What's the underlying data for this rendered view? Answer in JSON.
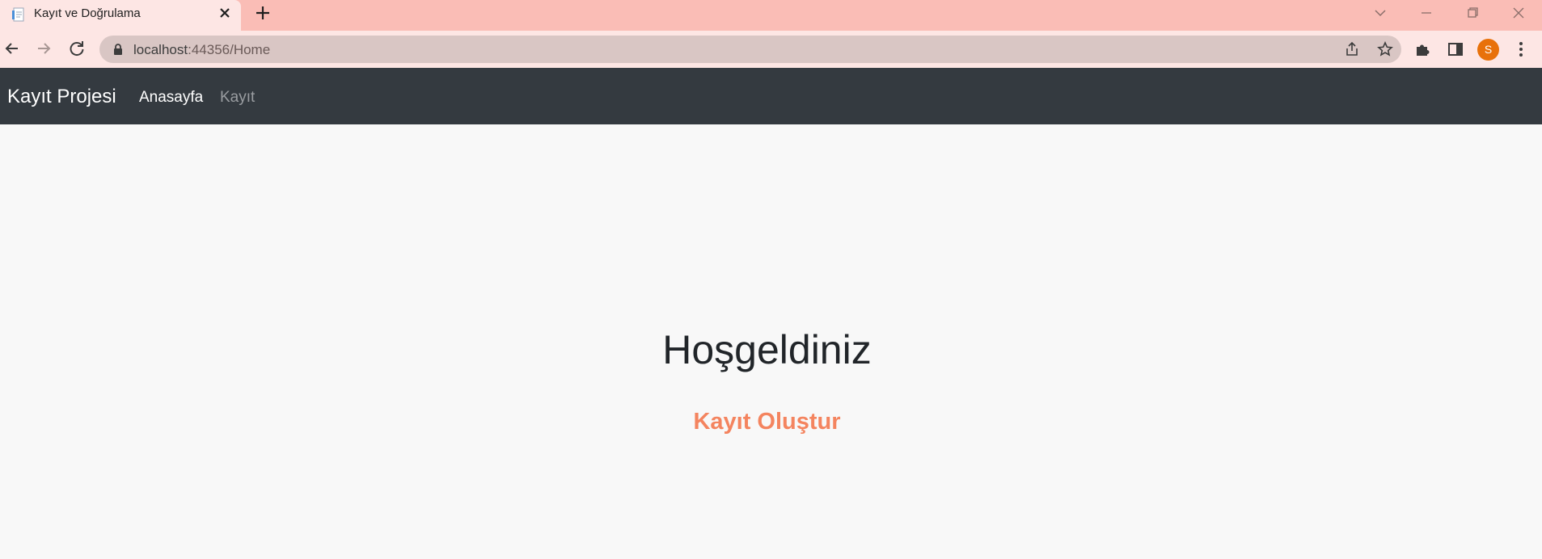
{
  "browser": {
    "tab_title": "Kayıt ve Doğrulama",
    "url_host": "localhost",
    "url_rest": ":44356/Home",
    "profile_initial": "S",
    "icons": {
      "favicon": "document-icon",
      "close": "close-icon",
      "new_tab": "plus-icon",
      "back": "back-arrow-icon",
      "forward": "forward-arrow-icon",
      "reload": "reload-icon",
      "lock": "lock-icon",
      "share": "share-icon",
      "bookmark": "star-icon",
      "extensions": "puzzle-icon",
      "side_panel": "side-panel-icon",
      "menu": "kebab-menu-icon"
    }
  },
  "navbar": {
    "brand": "Kayıt Projesi",
    "links": [
      {
        "label": "Anasayfa",
        "active": true
      },
      {
        "label": "Kayıt",
        "active": false
      }
    ]
  },
  "main": {
    "heading": "Hoşgeldiniz",
    "link_label": "Kayıt Oluştur"
  },
  "colors": {
    "navbar_bg": "#343a40",
    "link_accent": "#f4845f",
    "tab_strip": "#fabdb6",
    "page_bg": "#f8f8f8"
  }
}
